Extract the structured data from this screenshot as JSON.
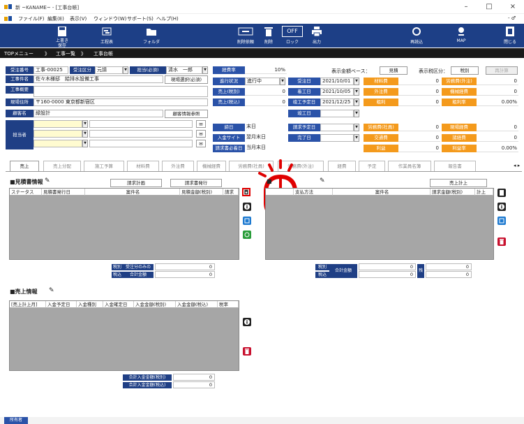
{
  "window": {
    "title": "新 ~KANAME~ - [工事台帳]",
    "min": "–",
    "max": "□",
    "close": "×",
    "inner_ctrl": "- ♂"
  },
  "menu": [
    "ファイル(F)",
    "編集(E)",
    "表示(V)",
    "ウィンドウ(W)",
    "サポート(S)",
    "ヘルプ(H)"
  ],
  "toolbar": {
    "save": "上書き\n保存",
    "schedule": "工程表",
    "folder": "フォルダ",
    "delete_request": "削除依頼",
    "delete": "削除",
    "lock": "ロック",
    "lock_state": "OFF",
    "print": "出力",
    "reload": "再読込",
    "map": "MAP",
    "close": "閉じる"
  },
  "breadcrumb": [
    "TOPメニュー",
    "工事一覧",
    "工事台帳"
  ],
  "header": {
    "order_no_label": "受注番号",
    "order_no": "工事-00025",
    "order_type_label": "受注区分",
    "order_type": "元請",
    "owner_label": "担当(必須)",
    "owner": "清水　一郎",
    "site_name_label": "工事件名",
    "site_name": "佐々木様邸　給排水設備工事",
    "site_select_btn": "現場選択(必須)",
    "overview_label": "工事概要",
    "address_label": "現場住所",
    "address": "〒160-0000 東京都新宿区",
    "customer_label": "顧客名",
    "customer": "緑設計",
    "customer_ref_btn": "顧客情報参照",
    "staff_label": "担当者",
    "expense_rate_label": "経費率",
    "expense_rate": "10%",
    "progress_label": "進行状況",
    "progress": "進行中",
    "sales_ex_label": "売上(税別)",
    "sales_ex": "0",
    "sales_in_label": "売上(税込)",
    "sales_in": "0",
    "closing_label": "締日",
    "closing": "末日",
    "site_label": "入金サイト",
    "site": "翌月末日",
    "billing_label": "請求書必着日",
    "billing": "当月末日",
    "order_date_label": "受注日",
    "order_date": "2021/10/01",
    "start_label": "着工日",
    "start": "2021/10/05",
    "end_plan_label": "竣工予定日",
    "end_plan": "2021/12/25",
    "end_label": "竣工日",
    "bill_plan_label": "請求予定日",
    "done_label": "完了日",
    "amount_base_label": "表示金額ベース：",
    "amount_base": "見積",
    "tax_label": "表示税区分：",
    "tax": "税別",
    "recalc": "再計算",
    "costs": [
      {
        "l": "材料費",
        "v": "0",
        "l2": "労務費(外注)",
        "v2": "0"
      },
      {
        "l": "外注費",
        "v": "0",
        "l2": "機械経費",
        "v2": "0"
      },
      {
        "l": "粗利",
        "v": "0",
        "l2": "粗利率",
        "v2": "0.00%"
      },
      {
        "l": "労務費(社員)",
        "v": "0",
        "l2": "現場経費",
        "v2": "0"
      },
      {
        "l": "交通費",
        "v": "0",
        "l2": "諸経費",
        "v2": "0"
      },
      {
        "l": "利益",
        "v": "0",
        "l2": "利益率",
        "v2": "0.00%"
      }
    ]
  },
  "tabs": [
    "売上",
    "売上分配",
    "施工予算",
    "材料費",
    "外注費",
    "機械経費",
    "労務費(社員)",
    "労務費(外注)",
    "経費",
    "予定",
    "作業員名簿",
    "報告書"
  ],
  "tab_scroll": "◂ ▸",
  "estimate": {
    "title": "■見積書情報",
    "btn_plan": "請求計画",
    "btn_issue": "請求書発行",
    "cols": [
      "ステータス",
      "見積書発行日",
      "案件名",
      "見積金額(税別)",
      "請求"
    ],
    "sum_rows": [
      {
        "l": "税別",
        "desc": "受注分のみの",
        "v": "0"
      },
      {
        "l": "税込",
        "desc": "合計金額",
        "v": "0"
      }
    ]
  },
  "invoice": {
    "title": "■",
    "btn_post": "売上計上",
    "cols": [
      "支払方法",
      "案件名",
      "請求金額(税別)",
      "計上"
    ],
    "sum": {
      "l1": "税別",
      "l2": "税込",
      "desc": "合計金額",
      "v1": "0",
      "v2": "0",
      "mid": "残",
      "v3": "0",
      "v4": "0"
    }
  },
  "sales": {
    "title": "■売上情報",
    "cols": [
      "[売上計上月]",
      "入金予定日",
      "入金種別",
      "入金確定日",
      "入金金額(税別)",
      "入金金額(税込)",
      "税率"
    ],
    "sum": [
      {
        "l": "合計入金金額(税別)",
        "v": "0"
      },
      {
        "l": "合計入金金額(税込)",
        "v": "0"
      }
    ]
  },
  "status": {
    "user": "所有者"
  },
  "colors": {
    "navy": "#1d3f86",
    "orange": "#f49a1c",
    "grid": "#a6a6a6",
    "accent_red": "#e00000"
  }
}
